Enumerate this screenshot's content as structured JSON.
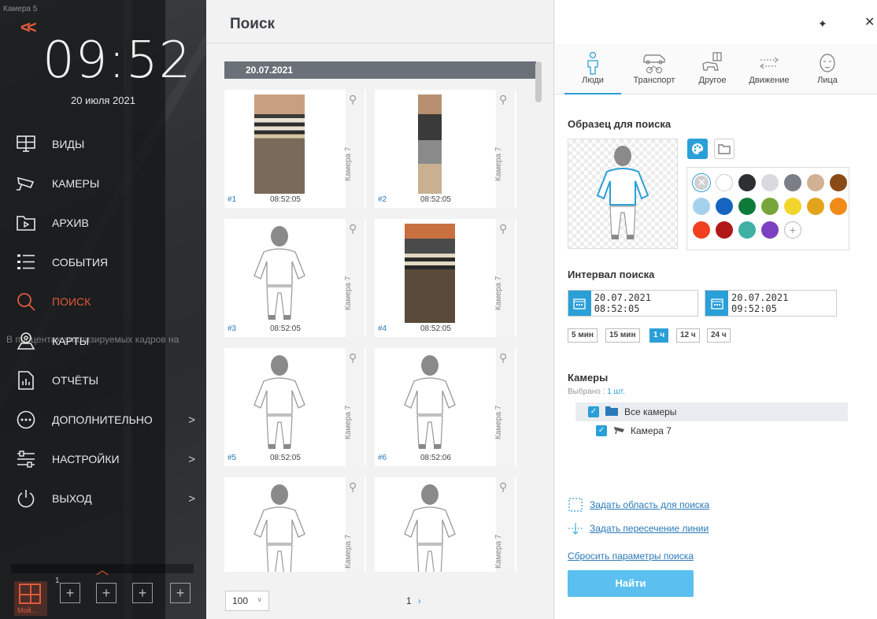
{
  "sidebar": {
    "camera_label": "Камера 5",
    "time": "09:52",
    "date": "20 июля 2021",
    "overlay_text": "В процентах анализируемых кадров на",
    "menu": [
      {
        "label": "Виды",
        "icon": "views-icon"
      },
      {
        "label": "Камеры",
        "icon": "camera-icon"
      },
      {
        "label": "Архив",
        "icon": "archive-icon"
      },
      {
        "label": "События",
        "icon": "events-icon"
      },
      {
        "label": "Поиск",
        "icon": "search-icon",
        "active": true
      },
      {
        "label": "Карты",
        "icon": "map-icon"
      },
      {
        "label": "Отчёты",
        "icon": "reports-icon"
      },
      {
        "label": "Дополнительно",
        "icon": "more-icon",
        "chevron": true
      },
      {
        "label": "Настройки",
        "icon": "settings-icon",
        "chevron": true
      },
      {
        "label": "Выход",
        "icon": "power-icon",
        "chevron": true
      }
    ],
    "layouts": {
      "my_label": "Мой...",
      "num": "1"
    }
  },
  "search": {
    "title": "Поиск",
    "date_group": "20.07.2021",
    "results": [
      {
        "num": "#1",
        "time": "08:52:05",
        "camera": "Камера 7",
        "kind": "photo"
      },
      {
        "num": "#2",
        "time": "08:52:05",
        "camera": "Камера 7",
        "kind": "photo"
      },
      {
        "num": "#3",
        "time": "08:52:05",
        "camera": "Камера 7",
        "kind": "figure"
      },
      {
        "num": "#4",
        "time": "08:52:05",
        "camera": "Камера 7",
        "kind": "photo"
      },
      {
        "num": "#5",
        "time": "08:52:05",
        "camera": "Камера 7",
        "kind": "figure"
      },
      {
        "num": "#6",
        "time": "08:52:06",
        "camera": "Камера 7",
        "kind": "figure"
      },
      {
        "num": "",
        "time": "",
        "camera": "Камера 7",
        "kind": "figure"
      },
      {
        "num": "",
        "time": "",
        "camera": "Камера 7",
        "kind": "figure"
      }
    ],
    "per_page": "100",
    "page": "1"
  },
  "filters": {
    "tabs": [
      {
        "label": "Люди",
        "icon": "person-icon",
        "active": true
      },
      {
        "label": "Транспорт",
        "icon": "vehicle-icon"
      },
      {
        "label": "Другое",
        "icon": "other-icon"
      },
      {
        "label": "Движение",
        "icon": "motion-icon"
      },
      {
        "label": "Лица",
        "icon": "face-icon"
      }
    ],
    "sample_heading": "Образец для поиска",
    "colors": [
      "none",
      "#ffffff",
      "#2d2f33",
      "#d9d9e0",
      "#7a7f86",
      "#d2b094",
      "#8a4a16",
      "#a6d1ec",
      "#1565c0",
      "#0d7a3a",
      "#78a53a",
      "#f2d52c",
      "#e2a41b",
      "#f28a18",
      "#f04020",
      "#b01818",
      "#3fb0a4",
      "#7b3fc0",
      "add"
    ],
    "interval_heading": "Интервал поиска",
    "from": "20.07.2021  08:52:05",
    "to": "20.07.2021  09:52:05",
    "presets": [
      {
        "label": "5 мин"
      },
      {
        "label": "15 мин"
      },
      {
        "label": "1 ч",
        "active": true
      },
      {
        "label": "12 ч"
      },
      {
        "label": "24 ч"
      }
    ],
    "cameras_heading": "Камеры",
    "selected_prefix": "Выбрано :",
    "selected_value": "1 шт.",
    "tree": [
      {
        "label": "Все камеры"
      },
      {
        "label": "Камера 7"
      }
    ],
    "links": [
      {
        "label": "Задать область для поиска"
      },
      {
        "label": "Задать пересечение линии"
      }
    ],
    "reset_label": "Сбросить параметры поиска",
    "find_label": "Найти"
  }
}
